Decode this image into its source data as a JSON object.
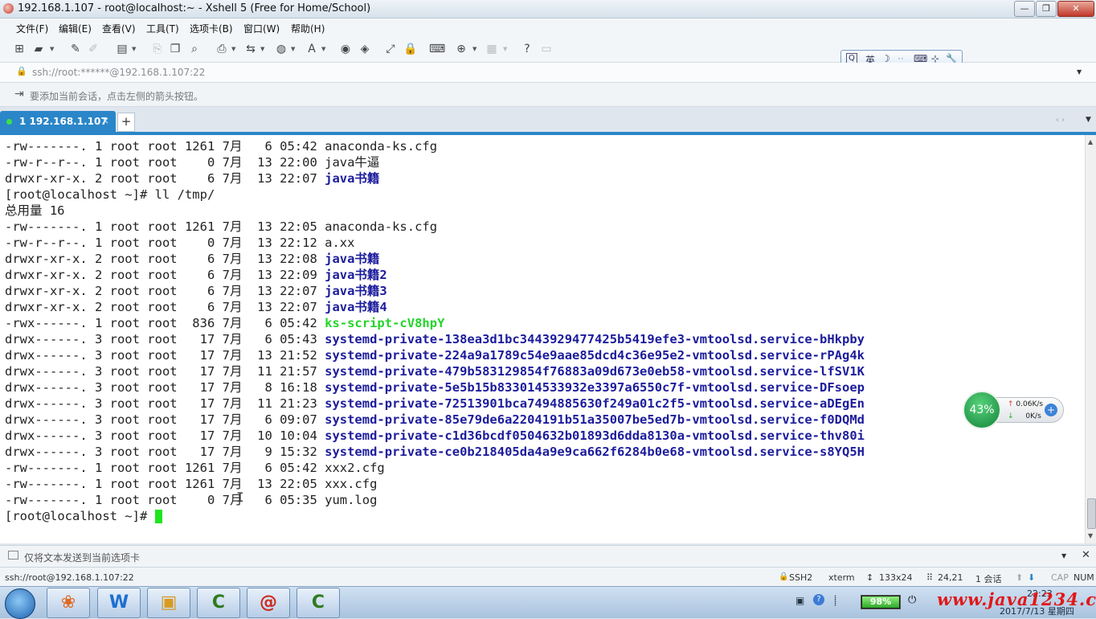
{
  "window": {
    "title": "192.168.1.107 - root@localhost:~ - Xshell 5 (Free for Home/School)",
    "minimize": "—",
    "maximize": "❐",
    "close": "✕"
  },
  "menu": [
    "文件(F)",
    "编辑(E)",
    "查看(V)",
    "工具(T)",
    "选项卡(B)",
    "窗口(W)",
    "帮助(H)"
  ],
  "ime": {
    "mode": "英",
    "moon": "☽",
    "dots": "··",
    "keyboard": "⌨",
    "grid": "⊹",
    "wrench": "🔧"
  },
  "address": {
    "text": "ssh://root:******@192.168.1.107:22",
    "lock": "🔒",
    "dropdown": "▼"
  },
  "hint": {
    "text": "要添加当前会话，点击左侧的箭头按钮。"
  },
  "tabs": [
    {
      "label": "1 192.168.1.107",
      "close": "×"
    }
  ],
  "tab_add": "+",
  "tab_nav": "‹ ›",
  "terminal": {
    "lines": [
      {
        "pre": "-rw-------. 1 root root 1261 7月   6 05:42 ",
        "name": "anaconda-ks.cfg",
        "kind": "file"
      },
      {
        "pre": "-rw-r--r--. 1 root root    0 7月  13 22:00 ",
        "name": "java牛逼",
        "kind": "file"
      },
      {
        "pre": "drwxr-xr-x. 2 root root    6 7月  13 22:07 ",
        "name": "java书籍",
        "kind": "dir"
      },
      {
        "pre": "[root@localhost ~]# ll /tmp/",
        "name": "",
        "kind": "file"
      },
      {
        "pre": "总用量 16",
        "name": "",
        "kind": "file"
      },
      {
        "pre": "-rw-------. 1 root root 1261 7月  13 22:05 ",
        "name": "anaconda-ks.cfg",
        "kind": "file"
      },
      {
        "pre": "-rw-r--r--. 1 root root    0 7月  13 22:12 ",
        "name": "a.xx",
        "kind": "file"
      },
      {
        "pre": "drwxr-xr-x. 2 root root    6 7月  13 22:08 ",
        "name": "java书籍",
        "kind": "dir"
      },
      {
        "pre": "drwxr-xr-x. 2 root root    6 7月  13 22:09 ",
        "name": "java书籍2",
        "kind": "dir"
      },
      {
        "pre": "drwxr-xr-x. 2 root root    6 7月  13 22:07 ",
        "name": "java书籍3",
        "kind": "dir"
      },
      {
        "pre": "drwxr-xr-x. 2 root root    6 7月  13 22:07 ",
        "name": "java书籍4",
        "kind": "dir"
      },
      {
        "pre": "-rwx------. 1 root root  836 7月   6 05:42 ",
        "name": "ks-script-cV8hpY",
        "kind": "exec"
      },
      {
        "pre": "drwx------. 3 root root   17 7月   6 05:43 ",
        "name": "systemd-private-138ea3d1bc3443929477425b5419efe3-vmtoolsd.service-bHkpby",
        "kind": "dir"
      },
      {
        "pre": "drwx------. 3 root root   17 7月  13 21:52 ",
        "name": "systemd-private-224a9a1789c54e9aae85dcd4c36e95e2-vmtoolsd.service-rPAg4k",
        "kind": "dir"
      },
      {
        "pre": "drwx------. 3 root root   17 7月  11 21:57 ",
        "name": "systemd-private-479b583129854f76883a09d673e0eb58-vmtoolsd.service-lfSV1K",
        "kind": "dir"
      },
      {
        "pre": "drwx------. 3 root root   17 7月   8 16:18 ",
        "name": "systemd-private-5e5b15b833014533932e3397a6550c7f-vmtoolsd.service-DFsoep",
        "kind": "dir"
      },
      {
        "pre": "drwx------. 3 root root   17 7月  11 21:23 ",
        "name": "systemd-private-72513901bca7494885630f249a01c2f5-vmtoolsd.service-aDEgEn",
        "kind": "dir"
      },
      {
        "pre": "drwx------. 3 root root   17 7月   6 09:07 ",
        "name": "systemd-private-85e79de6a2204191b51a35007be5ed7b-vmtoolsd.service-f0DQMd",
        "kind": "dir"
      },
      {
        "pre": "drwx------. 3 root root   17 7月  10 10:04 ",
        "name": "systemd-private-c1d36bcdf0504632b01893d6dda8130a-vmtoolsd.service-thv80i",
        "kind": "dir"
      },
      {
        "pre": "drwx------. 3 root root   17 7月   9 15:32 ",
        "name": "systemd-private-ce0b218405da4a9e9ca662f6284b0e68-vmtoolsd.service-s8YQ5H",
        "kind": "dir"
      },
      {
        "pre": "-rw-------. 1 root root 1261 7月   6 05:42 ",
        "name": "xxx2.cfg",
        "kind": "file"
      },
      {
        "pre": "-rw-------. 1 root root 1261 7月  13 22:05 ",
        "name": "xxx.cfg",
        "kind": "file"
      },
      {
        "pre": "-rw-------. 1 root root    0 7月   6 05:35 ",
        "name": "yum.log",
        "kind": "file"
      },
      {
        "pre": "[root@localhost ~]# ",
        "name": "",
        "kind": "prompt"
      }
    ]
  },
  "netwidget": {
    "percent": "43%",
    "up": "0.06K/s",
    "down": "0K/s",
    "up_arrow": "↑",
    "down_arrow": "↓",
    "plus": "+"
  },
  "sendbar": {
    "text": "仅将文本发送到当前选项卡",
    "dropdown": "▼"
  },
  "status": {
    "session": "ssh://root@192.168.1.107:22",
    "protocol": "SSH2",
    "term": "xterm",
    "size": "133x24",
    "cursor": "24,21",
    "sessions": "1 会话",
    "cap": "CAP",
    "num": "NUM"
  },
  "taskbar": {
    "apps": [
      {
        "name": "picasa",
        "glyph": "❀"
      },
      {
        "name": "wps",
        "glyph": "W"
      },
      {
        "name": "explorer",
        "glyph": "▣"
      },
      {
        "name": "camtasia",
        "glyph": "C"
      },
      {
        "name": "xshell",
        "glyph": "@"
      },
      {
        "name": "camtasia-recorder",
        "glyph": "C"
      }
    ],
    "battery": "98%",
    "watermark": "www.java1234.com",
    "time": "22:23",
    "date": "2017/7/13 星期四"
  },
  "colors": {
    "accent": "#2a86c8",
    "dir": "#1c1c9c",
    "exec": "#24d52a",
    "cursor": "#1ee51e"
  }
}
